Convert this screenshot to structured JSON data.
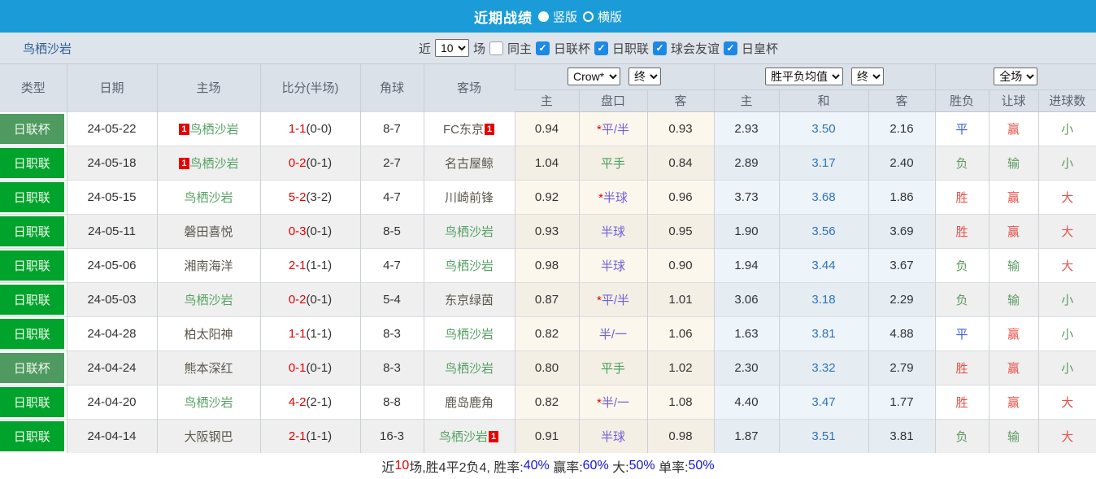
{
  "titlebar": {
    "title": "近期战绩",
    "options": [
      {
        "label": "竖版",
        "selected": true
      },
      {
        "label": "横版",
        "selected": false
      }
    ]
  },
  "filterbar": {
    "team": "鸟栖沙岩",
    "near_label": "近",
    "match_count": "10",
    "games_label": "场",
    "same_home": {
      "label": "同主",
      "checked": false
    },
    "league_filters": [
      {
        "label": "日联杯",
        "checked": true
      },
      {
        "label": "日职联",
        "checked": true
      },
      {
        "label": "球会友谊",
        "checked": true
      },
      {
        "label": "日皇杯",
        "checked": true
      }
    ]
  },
  "table": {
    "columns": {
      "type": "类型",
      "date": "日期",
      "home": "主场",
      "score": "比分(半场)",
      "corner": "角球",
      "away": "客场"
    },
    "group_selects": {
      "odds_company": "Crow*",
      "odds_final": "终",
      "avg": "胜平负均值",
      "avg_final": "终",
      "fulltime": "全场"
    },
    "subheaders": [
      "主",
      "盘口",
      "客",
      "主",
      "和",
      "客",
      "胜负",
      "让球",
      "进球数"
    ],
    "rows": [
      {
        "league": "日联杯",
        "league_kind": "cup",
        "date": "24-05-22",
        "home": {
          "name": "鸟栖沙岩",
          "focus": true,
          "badge": "1",
          "badge_pos": "before"
        },
        "score_full": "1-1",
        "score_half": "(0-0)",
        "corners": "8-7",
        "away": {
          "name": "FC东京",
          "focus": false,
          "badge": "1",
          "badge_pos": "after"
        },
        "odds": {
          "home": "0.94",
          "handicap_star": true,
          "handicap": "平/半",
          "handicap_kind": "purple",
          "away": "0.93"
        },
        "avg": {
          "home": "2.93",
          "draw": "3.50",
          "away": "2.16"
        },
        "outcome": {
          "result": "平",
          "handicap": "赢",
          "goals": "小"
        }
      },
      {
        "league": "日职联",
        "league_kind": "league",
        "date": "24-05-18",
        "home": {
          "name": "鸟栖沙岩",
          "focus": true,
          "badge": "1",
          "badge_pos": "before"
        },
        "score_full": "0-2",
        "score_half": "(0-1)",
        "corners": "2-7",
        "away": {
          "name": "名古屋鲸",
          "focus": false,
          "badge": "",
          "badge_pos": ""
        },
        "odds": {
          "home": "1.04",
          "handicap_star": false,
          "handicap": "平手",
          "handicap_kind": "green",
          "away": "0.84"
        },
        "avg": {
          "home": "2.89",
          "draw": "3.17",
          "away": "2.40"
        },
        "outcome": {
          "result": "负",
          "handicap": "输",
          "goals": "小"
        }
      },
      {
        "league": "日职联",
        "league_kind": "league",
        "date": "24-05-15",
        "home": {
          "name": "鸟栖沙岩",
          "focus": true,
          "badge": "",
          "badge_pos": ""
        },
        "score_full": "5-2",
        "score_half": "(3-2)",
        "corners": "4-7",
        "away": {
          "name": "川崎前锋",
          "focus": false,
          "badge": "",
          "badge_pos": ""
        },
        "odds": {
          "home": "0.92",
          "handicap_star": true,
          "handicap": "半球",
          "handicap_kind": "purple",
          "away": "0.96"
        },
        "avg": {
          "home": "3.73",
          "draw": "3.68",
          "away": "1.86"
        },
        "outcome": {
          "result": "胜",
          "handicap": "赢",
          "goals": "大"
        }
      },
      {
        "league": "日职联",
        "league_kind": "league",
        "date": "24-05-11",
        "home": {
          "name": "磐田喜悦",
          "focus": false,
          "badge": "",
          "badge_pos": ""
        },
        "score_full": "0-3",
        "score_half": "(0-1)",
        "corners": "8-5",
        "away": {
          "name": "鸟栖沙岩",
          "focus": true,
          "badge": "",
          "badge_pos": ""
        },
        "odds": {
          "home": "0.93",
          "handicap_star": false,
          "handicap": "半球",
          "handicap_kind": "purple",
          "away": "0.95"
        },
        "avg": {
          "home": "1.90",
          "draw": "3.56",
          "away": "3.69"
        },
        "outcome": {
          "result": "胜",
          "handicap": "赢",
          "goals": "大"
        }
      },
      {
        "league": "日职联",
        "league_kind": "league",
        "date": "24-05-06",
        "home": {
          "name": "湘南海洋",
          "focus": false,
          "badge": "",
          "badge_pos": ""
        },
        "score_full": "2-1",
        "score_half": "(1-1)",
        "corners": "4-7",
        "away": {
          "name": "鸟栖沙岩",
          "focus": true,
          "badge": "",
          "badge_pos": ""
        },
        "odds": {
          "home": "0.98",
          "handicap_star": false,
          "handicap": "半球",
          "handicap_kind": "purple",
          "away": "0.90"
        },
        "avg": {
          "home": "1.94",
          "draw": "3.44",
          "away": "3.67"
        },
        "outcome": {
          "result": "负",
          "handicap": "输",
          "goals": "大"
        }
      },
      {
        "league": "日职联",
        "league_kind": "league",
        "date": "24-05-03",
        "home": {
          "name": "鸟栖沙岩",
          "focus": true,
          "badge": "",
          "badge_pos": ""
        },
        "score_full": "0-2",
        "score_half": "(0-1)",
        "corners": "5-4",
        "away": {
          "name": "东京绿茵",
          "focus": false,
          "badge": "",
          "badge_pos": ""
        },
        "odds": {
          "home": "0.87",
          "handicap_star": true,
          "handicap": "平/半",
          "handicap_kind": "purple",
          "away": "1.01"
        },
        "avg": {
          "home": "3.06",
          "draw": "3.18",
          "away": "2.29"
        },
        "outcome": {
          "result": "负",
          "handicap": "输",
          "goals": "小"
        }
      },
      {
        "league": "日职联",
        "league_kind": "league",
        "date": "24-04-28",
        "home": {
          "name": "柏太阳神",
          "focus": false,
          "badge": "",
          "badge_pos": ""
        },
        "score_full": "1-1",
        "score_half": "(1-1)",
        "corners": "8-3",
        "away": {
          "name": "鸟栖沙岩",
          "focus": true,
          "badge": "",
          "badge_pos": ""
        },
        "odds": {
          "home": "0.82",
          "handicap_star": false,
          "handicap": "半/一",
          "handicap_kind": "purple",
          "away": "1.06"
        },
        "avg": {
          "home": "1.63",
          "draw": "3.81",
          "away": "4.88"
        },
        "outcome": {
          "result": "平",
          "handicap": "赢",
          "goals": "小"
        }
      },
      {
        "league": "日联杯",
        "league_kind": "cup",
        "date": "24-04-24",
        "home": {
          "name": "熊本深红",
          "focus": false,
          "badge": "",
          "badge_pos": ""
        },
        "score_full": "0-1",
        "score_half": "(0-1)",
        "corners": "8-3",
        "away": {
          "name": "鸟栖沙岩",
          "focus": true,
          "badge": "",
          "badge_pos": ""
        },
        "odds": {
          "home": "0.80",
          "handicap_star": false,
          "handicap": "平手",
          "handicap_kind": "green",
          "away": "1.02"
        },
        "avg": {
          "home": "2.30",
          "draw": "3.32",
          "away": "2.79"
        },
        "outcome": {
          "result": "胜",
          "handicap": "赢",
          "goals": "小"
        }
      },
      {
        "league": "日职联",
        "league_kind": "league",
        "date": "24-04-20",
        "home": {
          "name": "鸟栖沙岩",
          "focus": true,
          "badge": "",
          "badge_pos": ""
        },
        "score_full": "4-2",
        "score_half": "(2-1)",
        "corners": "8-8",
        "away": {
          "name": "鹿岛鹿角",
          "focus": false,
          "badge": "",
          "badge_pos": ""
        },
        "odds": {
          "home": "0.82",
          "handicap_star": true,
          "handicap": "半/一",
          "handicap_kind": "purple",
          "away": "1.08"
        },
        "avg": {
          "home": "4.40",
          "draw": "3.47",
          "away": "1.77"
        },
        "outcome": {
          "result": "胜",
          "handicap": "赢",
          "goals": "大"
        }
      },
      {
        "league": "日职联",
        "league_kind": "league",
        "date": "24-04-14",
        "home": {
          "name": "大阪钢巴",
          "focus": false,
          "badge": "",
          "badge_pos": ""
        },
        "score_full": "2-1",
        "score_half": "(1-1)",
        "corners": "16-3",
        "away": {
          "name": "鸟栖沙岩",
          "focus": true,
          "badge": "1",
          "badge_pos": "after"
        },
        "odds": {
          "home": "0.91",
          "handicap_star": false,
          "handicap": "半球",
          "handicap_kind": "purple",
          "away": "0.98"
        },
        "avg": {
          "home": "1.87",
          "draw": "3.51",
          "away": "3.81"
        },
        "outcome": {
          "result": "负",
          "handicap": "输",
          "goals": "大"
        }
      }
    ]
  },
  "footer": {
    "segments": [
      {
        "text": "近",
        "color": "dark"
      },
      {
        "text": "10",
        "color": "red"
      },
      {
        "text": "场,胜4平2负4, 胜率:",
        "color": "dark"
      },
      {
        "text": "40%",
        "color": "blue"
      },
      {
        "text": " 赢率:",
        "color": "dark"
      },
      {
        "text": "60%",
        "color": "blue"
      },
      {
        "text": " 大:",
        "color": "dark"
      },
      {
        "text": "50%",
        "color": "blue"
      },
      {
        "text": " 单率:",
        "color": "dark"
      },
      {
        "text": "50%",
        "color": "blue"
      }
    ]
  }
}
